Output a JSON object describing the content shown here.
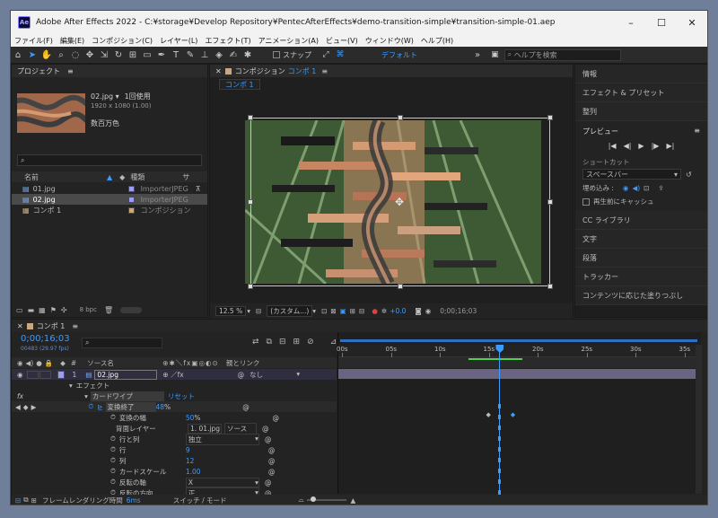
{
  "window": {
    "title": "Adobe After Effects 2022 - C:¥storage¥Develop Repository¥PentecAfterEffects¥demo-transition-simple¥transition-simple-01.aep *",
    "app_badge": "Ae"
  },
  "menu": [
    "ファイル(F)",
    "編集(E)",
    "コンポジション(C)",
    "レイヤー(L)",
    "エフェクト(T)",
    "アニメーション(A)",
    "ビュー(V)",
    "ウィンドウ(W)",
    "ヘルプ(H)"
  ],
  "toolbar": {
    "snap_label": "スナップ",
    "workspace": "デフォルト",
    "search_placeholder": "ヘルプを検索"
  },
  "project": {
    "title": "プロジェクト",
    "selected_name": "02.jpg ▾",
    "usage": "1回使用",
    "dimensions": "1920 x 1080 (1.00)",
    "colors": "数百万色",
    "search_placeholder": "",
    "columns": {
      "name": "名前",
      "type": "種類",
      "size": "サ"
    },
    "items": [
      {
        "name": "01.jpg",
        "type": "ImporterJPEG",
        "color": "#9d9df0"
      },
      {
        "name": "02.jpg",
        "type": "ImporterJPEG",
        "color": "#9d9df0"
      },
      {
        "name": "コンポ 1",
        "type": "コンポジション",
        "color": "#c8a880"
      }
    ],
    "bpc": "8 bpc"
  },
  "composition": {
    "title_prefix": "コンポジション",
    "title_comp": "コンポ 1",
    "tab": "コンポ 1",
    "zoom": "12.5 %",
    "resolution": "(カスタム...)",
    "exposure": "+0.0",
    "timecode": "0;00;16;03"
  },
  "right_panel": {
    "items_top": [
      "情報",
      "エフェクト & プリセット",
      "整列"
    ],
    "preview": {
      "title": "プレビュー",
      "shortcut_label": "ショートカット",
      "shortcut_value": "スペースバー",
      "include_label": "埋め込み :",
      "cache_label": "再生前にキャッシュ"
    },
    "items_bottom": [
      "CC ライブラリ",
      "文字",
      "段落",
      "トラッカー",
      "コンテンツに応じた塗りつぶし"
    ]
  },
  "timeline": {
    "tab": "コンポ 1",
    "timecode": "0;00;16;03",
    "frames": "00483 (29.97 fps)",
    "col_source": "ソース名",
    "col_parent": "親とリンク",
    "layer": {
      "index": "1",
      "name": "02.jpg",
      "parent": "なし"
    },
    "effects_label": "エフェクト",
    "effect_name": "カードワイプ",
    "reset": "リセット",
    "properties": [
      {
        "label": "変換終了",
        "value": "48",
        "unit": "%"
      },
      {
        "label": "変換の幅",
        "value": "50",
        "unit": "%"
      },
      {
        "label": "背面レイヤー",
        "value": "1. 01.jpg",
        "unit": "ソース"
      },
      {
        "label": "行と列",
        "value": "独立",
        "unit": ""
      },
      {
        "label": "行",
        "value": "9",
        "unit": ""
      },
      {
        "label": "列",
        "value": "12",
        "unit": ""
      },
      {
        "label": "カードスケール",
        "value": "1.00",
        "unit": ""
      },
      {
        "label": "反転の軸",
        "value": "X",
        "unit": ""
      },
      {
        "label": "反転の方向",
        "value": "正",
        "unit": ""
      }
    ],
    "ruler": [
      "00s",
      "05s",
      "10s",
      "15s",
      "20s",
      "25s",
      "30s",
      "35s"
    ],
    "playhead_seconds": 16.1,
    "keyframes_seconds": [
      15.0,
      17.5
    ],
    "render_label": "フレームレンダリング時間",
    "render_time": "6ms",
    "switch_mode": "スイッチ / モード"
  }
}
